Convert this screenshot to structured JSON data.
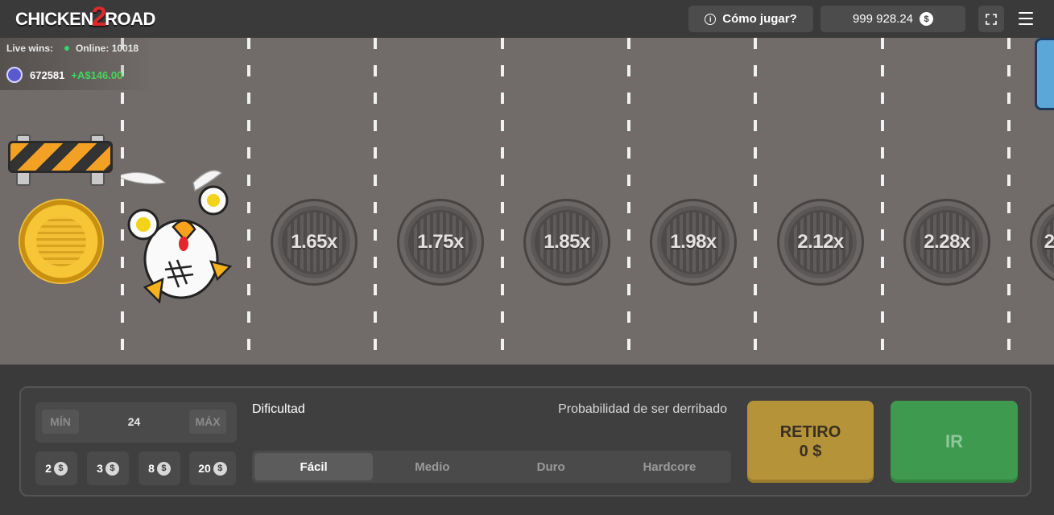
{
  "header": {
    "logo": {
      "part1": "CHICKEN",
      "part2": "2",
      "part3": "ROAD"
    },
    "how_to_play": "Cómo jugar?",
    "balance": "999 928.24",
    "currency_symbol": "$"
  },
  "live": {
    "label": "Live wins:",
    "online_label": "Online:",
    "online_count": "10018",
    "last_win_user": "672581",
    "last_win_amount": "+A$146.00"
  },
  "lanes": {
    "multipliers": [
      "1.65x",
      "1.75x",
      "1.85x",
      "1.98x",
      "2.12x",
      "2.28x",
      "2"
    ]
  },
  "controls": {
    "bet_min": "MÍN",
    "bet_value": "24",
    "bet_max": "MÁX",
    "quick_bets": [
      "2",
      "3",
      "8",
      "20"
    ],
    "difficulty_label": "Dificultad",
    "probability_label": "Probabilidad de ser derribado",
    "difficulties": [
      "Fácil",
      "Medio",
      "Duro",
      "Hardcore"
    ],
    "active_difficulty": "Fácil",
    "cashout_label": "RETIRO",
    "cashout_amount": "0 $",
    "go_label": "IR"
  },
  "colors": {
    "road": "#716c6a",
    "header": "#3a3a3a",
    "cashout": "#b59338",
    "go": "#3d9a4e",
    "win_green": "#43d65b"
  }
}
